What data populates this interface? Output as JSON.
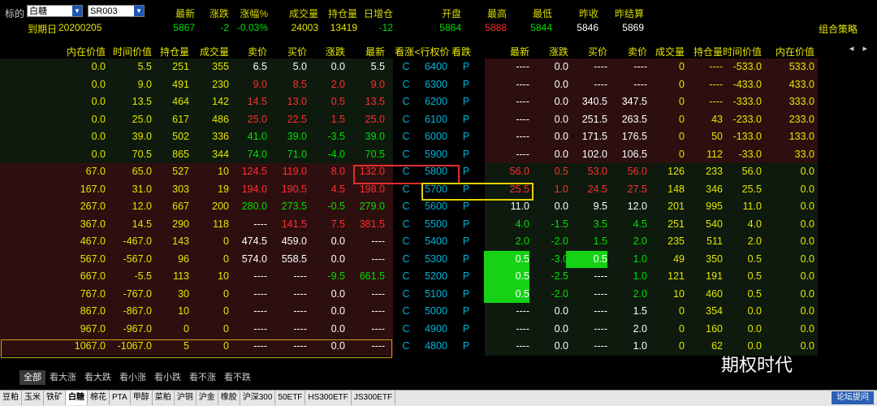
{
  "header": {
    "underlying_label": "标的",
    "underlying_value": "白糖",
    "contract_value": "SR003",
    "expiry_label": "到期日",
    "expiry_value": "20200205",
    "strategy_label": "组合策略",
    "quote_labels": [
      "最新",
      "涨跌",
      "涨幅%",
      "成交量",
      "持仓量",
      "日增仓",
      "开盘",
      "最高",
      "最低",
      "昨收",
      "昨结算"
    ],
    "quote_values": [
      "5867",
      "-2",
      "-0.03%",
      "24003",
      "13419",
      "-12",
      "5864",
      "5888",
      "5844",
      "5846",
      "5869"
    ],
    "quote_colors": [
      "#00e000",
      "#00e000",
      "#00e000",
      "#e6e600",
      "#e6e600",
      "#00e000",
      "#00e000",
      "#ff3030",
      "#00e000",
      "#ffffff",
      "#ffffff"
    ]
  },
  "columns": [
    "内在价值",
    "时间价值",
    "持仓量",
    "成交量",
    "卖价",
    "买价",
    "涨跌",
    "最新",
    "看涨",
    "<行权价>",
    "看跌",
    "最新",
    "涨跌",
    "买价",
    "卖价",
    "成交量",
    "持仓量",
    "时间价值",
    "内在价值"
  ],
  "nav_arrows": "◂ ▸",
  "rows": [
    {
      "call": [
        "0.0",
        "5.5",
        "251",
        "355",
        "6.5",
        "5.0",
        "0.0",
        "5.5"
      ],
      "strike": "6400",
      "put": [
        "----",
        "0.0",
        "----",
        "----",
        "0",
        "----",
        "-533.0",
        "533.0"
      ]
    },
    {
      "call": [
        "0.0",
        "9.0",
        "491",
        "230",
        "9.0",
        "8.5",
        "2.0",
        "9.0"
      ],
      "strike": "6300",
      "put": [
        "----",
        "0.0",
        "----",
        "----",
        "0",
        "----",
        "-433.0",
        "433.0"
      ]
    },
    {
      "call": [
        "0.0",
        "13.5",
        "464",
        "142",
        "14.5",
        "13.0",
        "0.5",
        "13.5"
      ],
      "strike": "6200",
      "put": [
        "----",
        "0.0",
        "340.5",
        "347.5",
        "0",
        "----",
        "-333.0",
        "333.0"
      ]
    },
    {
      "call": [
        "0.0",
        "25.0",
        "617",
        "486",
        "25.0",
        "22.5",
        "1.5",
        "25.0"
      ],
      "strike": "6100",
      "put": [
        "----",
        "0.0",
        "251.5",
        "263.5",
        "0",
        "43",
        "-233.0",
        "233.0"
      ]
    },
    {
      "call": [
        "0.0",
        "39.0",
        "502",
        "336",
        "41.0",
        "39.0",
        "-3.5",
        "39.0"
      ],
      "strike": "6000",
      "put": [
        "----",
        "0.0",
        "171.5",
        "176.5",
        "0",
        "50",
        "-133.0",
        "133.0"
      ]
    },
    {
      "call": [
        "0.0",
        "70.5",
        "865",
        "344",
        "74.0",
        "71.0",
        "-4.0",
        "70.5"
      ],
      "strike": "5900",
      "put": [
        "----",
        "0.0",
        "102.0",
        "106.5",
        "0",
        "112",
        "-33.0",
        "33.0"
      ]
    },
    {
      "call": [
        "67.0",
        "65.0",
        "527",
        "10",
        "124.5",
        "119.0",
        "8.0",
        "132.0"
      ],
      "strike": "5800",
      "put": [
        "56.0",
        "0.5",
        "53.0",
        "56.0",
        "126",
        "233",
        "56.0",
        "0.0"
      ]
    },
    {
      "call": [
        "167.0",
        "31.0",
        "303",
        "19",
        "194.0",
        "190.5",
        "4.5",
        "198.0"
      ],
      "strike": "5700",
      "put": [
        "25.5",
        "1.0",
        "24.5",
        "27.5",
        "148",
        "346",
        "25.5",
        "0.0"
      ]
    },
    {
      "call": [
        "267.0",
        "12.0",
        "667",
        "200",
        "280.0",
        "273.5",
        "-0.5",
        "279.0"
      ],
      "strike": "5600",
      "put": [
        "11.0",
        "0.0",
        "9.5",
        "12.0",
        "201",
        "995",
        "11.0",
        "0.0"
      ]
    },
    {
      "call": [
        "367.0",
        "14.5",
        "290",
        "118",
        "----",
        "141.5",
        "7.5",
        "381.5"
      ],
      "strike": "5500",
      "put": [
        "4.0",
        "-1.5",
        "3.5",
        "4.5",
        "251",
        "540",
        "4.0",
        "0.0"
      ]
    },
    {
      "call": [
        "467.0",
        "-467.0",
        "143",
        "0",
        "474.5",
        "459.0",
        "0.0",
        "----"
      ],
      "strike": "5400",
      "put": [
        "2.0",
        "-2.0",
        "1.5",
        "2.0",
        "235",
        "511",
        "2.0",
        "0.0"
      ]
    },
    {
      "call": [
        "567.0",
        "-567.0",
        "96",
        "0",
        "574.0",
        "558.5",
        "0.0",
        "----"
      ],
      "strike": "5300",
      "put": [
        "0.5",
        "-3.0",
        "0.5",
        "1.0",
        "49",
        "350",
        "0.5",
        "0.0"
      ]
    },
    {
      "call": [
        "667.0",
        "-5.5",
        "113",
        "10",
        "----",
        "----",
        "-9.5",
        "661.5"
      ],
      "strike": "5200",
      "put": [
        "0.5",
        "-2.5",
        "----",
        "1.0",
        "121",
        "191",
        "0.5",
        "0.0"
      ]
    },
    {
      "call": [
        "767.0",
        "-767.0",
        "30",
        "0",
        "----",
        "----",
        "0.0",
        "----"
      ],
      "strike": "5100",
      "put": [
        "0.5",
        "-2.0",
        "----",
        "2.0",
        "10",
        "460",
        "0.5",
        "0.0"
      ]
    },
    {
      "call": [
        "867.0",
        "-867.0",
        "10",
        "0",
        "----",
        "----",
        "0.0",
        "----"
      ],
      "strike": "5000",
      "put": [
        "----",
        "0.0",
        "----",
        "1.5",
        "0",
        "354",
        "0.0",
        "0.0"
      ]
    },
    {
      "call": [
        "967.0",
        "-967.0",
        "0",
        "0",
        "----",
        "----",
        "0.0",
        "----"
      ],
      "strike": "4900",
      "put": [
        "----",
        "0.0",
        "----",
        "2.0",
        "0",
        "160",
        "0.0",
        "0.0"
      ]
    },
    {
      "call": [
        "1067.0",
        "-1067.0",
        "5",
        "0",
        "----",
        "----",
        "0.0",
        "----"
      ],
      "strike": "4800",
      "put": [
        "----",
        "0.0",
        "----",
        "1.0",
        "0",
        "62",
        "0.0",
        "0.0"
      ]
    }
  ],
  "call_letter": "C",
  "put_letter": "P",
  "filter_tabs": [
    "全部",
    "看大涨",
    "看大跌",
    "看小涨",
    "看小跌",
    "看不涨",
    "看不跌"
  ],
  "bottom_tabs": [
    "豆粕",
    "玉米",
    "铁矿",
    "白糖",
    "棉花",
    "PTA",
    "甲醇",
    "菜粕",
    "沪铜",
    "沪金",
    "橡胶",
    "沪深300",
    "50ETF",
    "HS300ETF",
    "JS300ETF"
  ],
  "forum_label": "论坛提问",
  "watermark": "期权时代",
  "colors": {
    "up": "#ff3030",
    "down": "#00e000",
    "neutral": "#ffffff",
    "volume": "#e6e600",
    "strike": "#00b4d8",
    "itm_call_bg": "#2e0f0f",
    "otm_call_bg": "#0d1a0d",
    "highlight": "#16d216",
    "red_box": "#e03030",
    "yellow_box": "#e6d200"
  }
}
